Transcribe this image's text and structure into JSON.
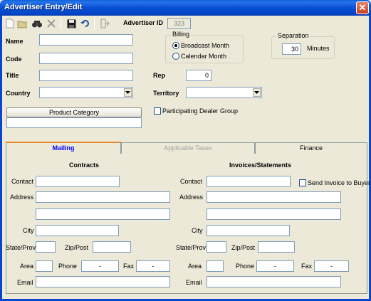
{
  "window": {
    "title": "Advertiser Entry/Edit",
    "close_symbol": "✕"
  },
  "toolbar": {
    "buttons": [
      {
        "name": "new-icon"
      },
      {
        "name": "open-icon"
      },
      {
        "name": "find-icon"
      },
      {
        "name": "delete-icon"
      },
      {
        "name": "save-icon"
      },
      {
        "name": "undo-icon"
      },
      {
        "name": "exit-icon"
      }
    ]
  },
  "header": {
    "advertiser_id_label": "Advertiser ID",
    "advertiser_id_value": "323"
  },
  "form": {
    "name_label": "Name",
    "name_value": "",
    "code_label": "Code",
    "code_value": "",
    "title_label": "Title",
    "title_value": "",
    "country_label": "Country",
    "country_value": "",
    "rep_label": "Rep",
    "rep_value": "0",
    "territory_label": "Territory",
    "territory_value": ""
  },
  "billing": {
    "title": "Billing",
    "options": [
      "Broadcast Month",
      "Calendar Month"
    ],
    "selected": "Broadcast Month"
  },
  "separation": {
    "title": "Separation",
    "value": "30",
    "unit": "Minutes"
  },
  "product_category": {
    "button_label": "Product Category",
    "value": ""
  },
  "participating_dealer_group": {
    "label": "Participating Dealer Group",
    "checked": false
  },
  "tabs": [
    {
      "label": "Mailing",
      "state": "active"
    },
    {
      "label": "Applicable Taxes",
      "state": "disabled"
    },
    {
      "label": "Finance",
      "state": "normal"
    }
  ],
  "contracts": {
    "heading": "Contracts",
    "contact_label": "Contact",
    "contact_value": "",
    "address_label": "Address",
    "address1_value": "",
    "address2_value": "",
    "city_label": "City",
    "city_value": "",
    "state_label": "State/Prov",
    "state_value": "",
    "zip_label": "Zip/Post",
    "zip_value": "",
    "area_label": "Area",
    "area_value": "",
    "phone_label": "Phone",
    "phone_value": "-",
    "fax_label": "Fax",
    "fax_value": "-",
    "email_label": "Email",
    "email_value": ""
  },
  "invoices": {
    "heading": "Invoices/Statements",
    "send_invoice_label": "Send Invoice to Buyer",
    "send_invoice_checked": false,
    "contact_label": "Contact",
    "contact_value": "",
    "address_label": "Address",
    "address1_value": "",
    "address2_value": "",
    "city_label": "City",
    "city_value": "",
    "state_label": "State/Prov",
    "state_value": "",
    "zip_label": "Zip/Post",
    "zip_value": "",
    "area_label": "Area",
    "area_value": "",
    "phone_label": "Phone",
    "phone_value": "-",
    "fax_label": "Fax",
    "fax_value": "-",
    "email_label": "Email",
    "email_value": ""
  }
}
